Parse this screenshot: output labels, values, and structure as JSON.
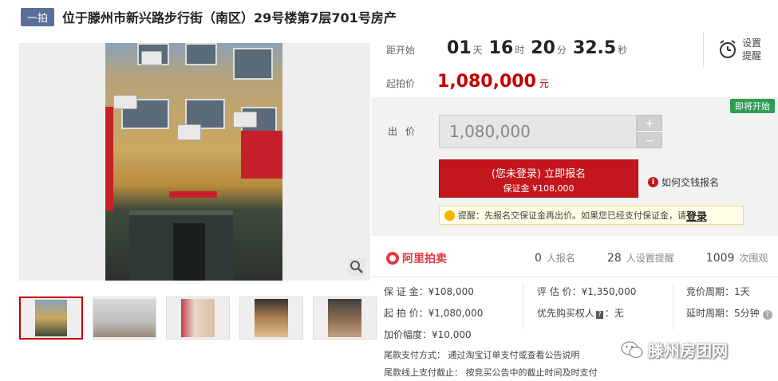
{
  "header": {
    "badge": "一拍",
    "title": "位于滕州市新兴路步行街（南区）29号楼第7层701号房产"
  },
  "countdown": {
    "label": "距开始",
    "days": "01",
    "days_unit": "天",
    "hours": "16",
    "hours_unit": "时",
    "minutes": "20",
    "minutes_unit": "分",
    "seconds": "32.5",
    "seconds_unit": "秒"
  },
  "reminder": {
    "label": "设置提醒",
    "icon": "alarm-clock-icon"
  },
  "start_price": {
    "label": "起拍价",
    "value": "1,080,000",
    "unit": "元"
  },
  "status_badge": "即将开始",
  "bid": {
    "label": "出价",
    "value": "1,080,000",
    "plus": "+",
    "minus": "−"
  },
  "signup": {
    "main": "(您未登录) 立即报名",
    "sub": "保证金 ¥108,000"
  },
  "howto": "如何交钱报名",
  "tip": {
    "text": "提醒：先报名交保证金再出价。如果您已经支付保证金，请",
    "link": "登录"
  },
  "stats": {
    "logo": "阿里拍卖",
    "signups_count": "0",
    "signups_label": "人报名",
    "reminders_count": "28",
    "reminders_label": "人设置提醒",
    "views_count": "1009",
    "views_label": "次围观"
  },
  "details": {
    "deposit": "保 证 金：¥108,000",
    "start_price": "起 拍 价：¥1,080,000",
    "increment": "加价幅度：¥10,000",
    "appraisal": "评 估 价：¥1,350,000",
    "priority_label": "优先购买权人",
    "priority_tag": "?",
    "priority_value": "：无",
    "bid_cycle": "竞价周期：1天",
    "extension": "延时周期：5分钟",
    "payment_method": "尾款支付方式： 通过淘宝订单支付或查看公告说明",
    "payment_deadline": "尾款线上支付截止： 按竞买公告中的截止时间及时支付"
  },
  "watermark": "滕州房团网",
  "colors": {
    "accent": "#c4161c",
    "badge": "#5b6f96",
    "soon": "#2f9d55",
    "logo": "#e4393c"
  }
}
